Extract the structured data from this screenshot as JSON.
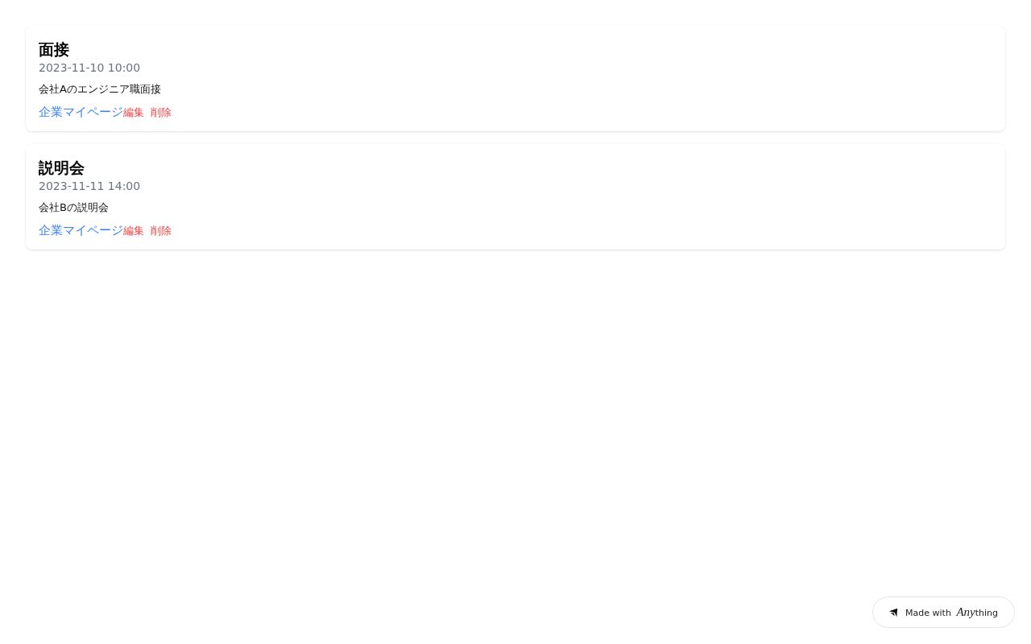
{
  "events": [
    {
      "title": "面接",
      "datetime": "2023-11-10 10:00",
      "description": "会社Aのエンジニア職面接",
      "link": "企業マイページ",
      "actions": [
        "編集",
        "削除"
      ]
    },
    {
      "title": "説明会",
      "datetime": "2023-11-11 14:00",
      "description": "会社Bの説明会",
      "link": "企業マイページ",
      "actions": [
        "編集",
        "削除"
      ]
    }
  ],
  "badge": {
    "label": "Made with",
    "brand": [
      "Any",
      "thing"
    ]
  }
}
